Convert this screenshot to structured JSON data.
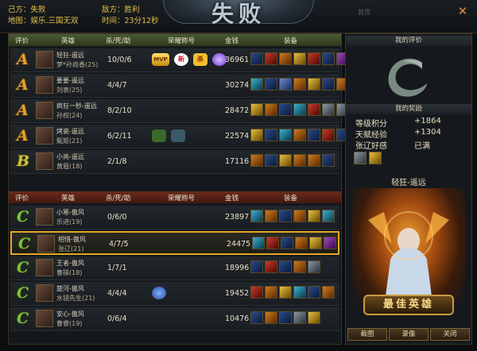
{
  "header": {
    "my_side_label": "己方：失败",
    "enemy_label": "敌方：胜利",
    "map_label": "地图：娱乐.三国无双",
    "time_label": "时间：23分12秒",
    "title": "失败",
    "ghost_1": "首页",
    "ghost_2": "1",
    "close_icon": "close-icon"
  },
  "table_headers": {
    "grade": "评价",
    "hero": "英雄",
    "kda": "杀/死/助",
    "honor": "荣耀称号",
    "gold": "金钱",
    "equip": "装备"
  },
  "team_win": [
    {
      "grade": "A",
      "player": "轻狂-遥远",
      "hero": "梦*孙尚香(25)",
      "kda": "10/0/6",
      "honors": [
        "mvp",
        "new",
        "sha",
        "gem"
      ],
      "gold": "36961",
      "equip": [
        "e1",
        "e3",
        "e2",
        "e4",
        "e3",
        "e1",
        "e6"
      ]
    },
    {
      "grade": "A",
      "player": "要要-遥远",
      "hero": "刘表(25)",
      "kda": "4/4/7",
      "honors": [],
      "gold": "30274",
      "equip": [
        "e7",
        "e1",
        "e5",
        "e2",
        "e4",
        "e1",
        "e2"
      ]
    },
    {
      "grade": "A",
      "player": "疯狂一秒-遥远",
      "hero": "孙权(24)",
      "kda": "8/2/10",
      "honors": [],
      "gold": "28472",
      "equip": [
        "e4",
        "e2",
        "e1",
        "e7",
        "e3",
        "e8",
        "e8"
      ]
    },
    {
      "grade": "A",
      "player": "烤瓷-遥远",
      "hero": "甄姬(21)",
      "kda": "6/2/11",
      "honors": [
        "gleaf",
        "shield"
      ],
      "gold": "22574",
      "equip": [
        "e4",
        "e1",
        "e7",
        "e2",
        "e1",
        "e3",
        "e1"
      ]
    },
    {
      "grade": "B",
      "player": "小亮-遥远",
      "hero": "黄眉(18)",
      "kda": "2/1/8",
      "honors": [],
      "gold": "17116",
      "equip": [
        "e2",
        "e1",
        "e4",
        "e2",
        "e2",
        "e1"
      ]
    }
  ],
  "team_lose": [
    {
      "grade": "C",
      "player": "小寒-傲风",
      "hero": "乐进(19)",
      "kda": "0/6/0",
      "honors": [],
      "gold": "23897",
      "equip": [
        "e7",
        "e2",
        "e1",
        "e2",
        "e4",
        "e7"
      ]
    },
    {
      "grade": "C",
      "player": "相惜-傲风",
      "hero": "张辽(21)",
      "kda": "4/7/5",
      "honors": [],
      "gold": "24475",
      "equip": [
        "e7",
        "e3",
        "e1",
        "e2",
        "e4",
        "e6"
      ],
      "selected": true
    },
    {
      "grade": "C",
      "player": "王者-傲风",
      "hero": "曹操(18)",
      "kda": "1/7/1",
      "honors": [],
      "gold": "18996",
      "equip": [
        "e1",
        "e3",
        "e1",
        "e2",
        "e8"
      ]
    },
    {
      "grade": "C",
      "player": "楚河-傲风",
      "hero": "水镜先生(21)",
      "kda": "4/4/4",
      "honors": [
        "blue"
      ],
      "gold": "19452",
      "equip": [
        "e3",
        "e2",
        "e4",
        "e7",
        "e1",
        "e2"
      ]
    },
    {
      "grade": "C",
      "player": "安心-傲风",
      "hero": "曹睿(19)",
      "kda": "0/6/4",
      "honors": [],
      "gold": "10476",
      "equip": [
        "e1",
        "e2",
        "e1",
        "e8",
        "e4"
      ]
    }
  ],
  "honor_labels": {
    "mvp": "MVP",
    "new": "新",
    "sha": "杀",
    "gem": "",
    "gleaf": "",
    "shield": "",
    "blue": ""
  },
  "right": {
    "my_eval_title": "我的评价",
    "my_reward_title": "我的奖励",
    "reward_lines": [
      {
        "label": "等级积分",
        "value": "+1864"
      },
      {
        "label": "天赋经验",
        "value": "+1304"
      },
      {
        "label": "张辽好感",
        "value": "已满"
      }
    ],
    "best_player": "轻狂-遥远",
    "best_banner": "最佳英雄",
    "buttons": [
      "截图",
      "录像",
      "关闭"
    ]
  }
}
